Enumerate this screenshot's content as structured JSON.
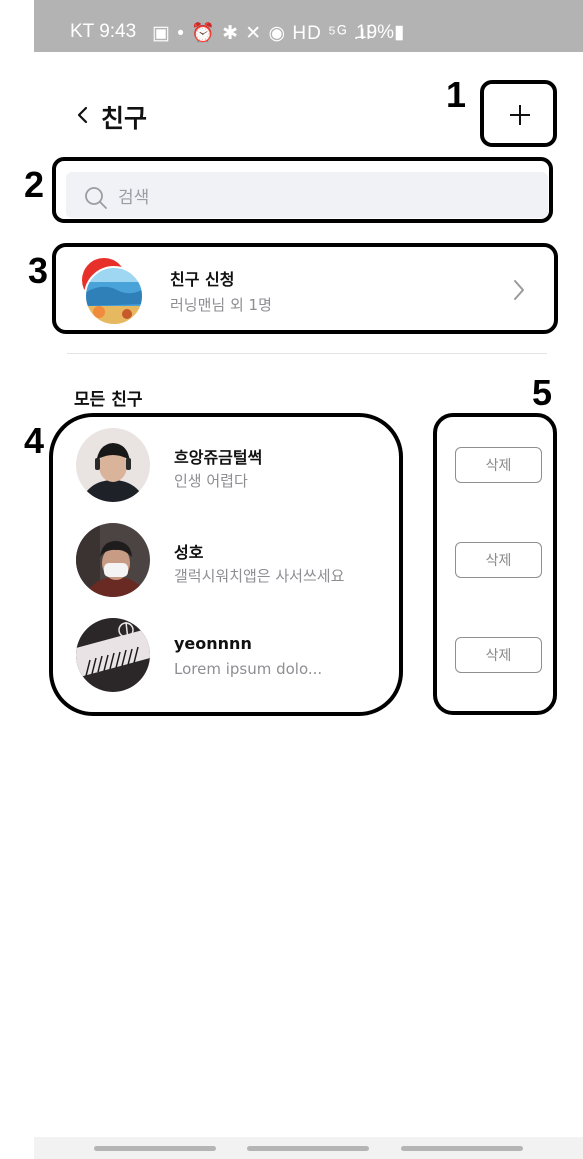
{
  "status_bar": {
    "carrier_time": "KT 9:43",
    "system_icons": "▣ • ⏰ ✱ ✕ ◉ HD ⁵ᴳ .ıl",
    "battery": "19%▮"
  },
  "header": {
    "back_icon": "chevron-left-icon",
    "title": "친구",
    "add_icon": "plus-icon"
  },
  "annotations": [
    "1",
    "2",
    "3",
    "4",
    "5"
  ],
  "search": {
    "placeholder": "검색",
    "value": "",
    "icon": "search-icon"
  },
  "friend_request": {
    "title": "친구 신청",
    "subtitle": "러닝맨님 외 1명",
    "chevron_icon": "chevron-right-icon"
  },
  "section_label": "모든 친구",
  "friends": [
    {
      "name": "흐앙쥬금털썩",
      "status": "인생 어렵다",
      "delete_label": "삭제"
    },
    {
      "name": "성호",
      "status": "갤럭시워치앱은 사서쓰세요",
      "delete_label": "삭제"
    },
    {
      "name": "yeonnnn",
      "status": "Lorem ipsum dolo...",
      "delete_label": "삭제"
    }
  ],
  "colors": {
    "status_bar": "#b3b3b3",
    "search_bg": "#f1f2f6",
    "secondary_text": "#8e8e93",
    "annotation_frame": "#000000"
  }
}
